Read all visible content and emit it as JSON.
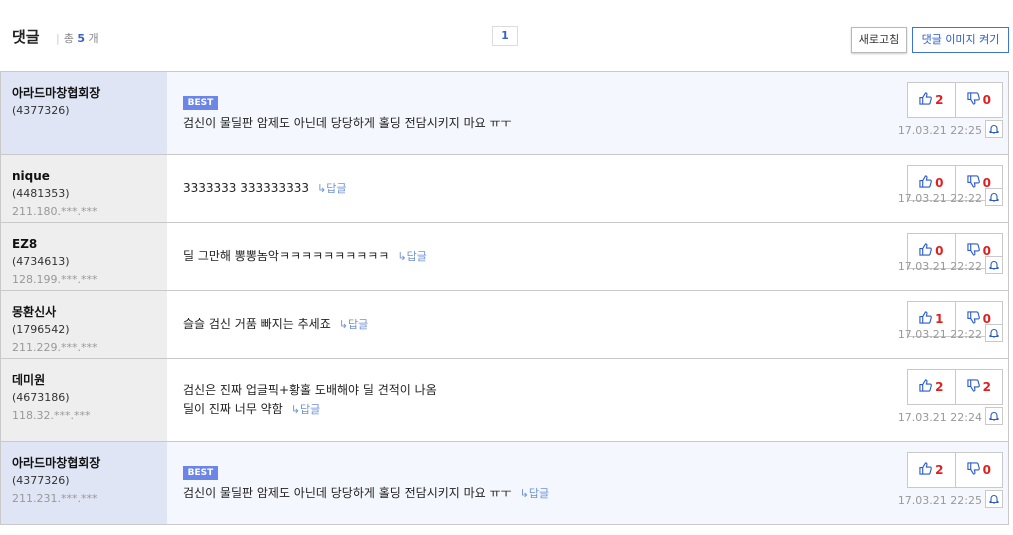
{
  "header": {
    "title": "댓글",
    "count_prefix": "총",
    "count": "5",
    "count_suffix": "개",
    "page": "1",
    "refresh_label": "새로고침",
    "image_toggle_label": "댓글 이미지 켜기"
  },
  "comments": [
    {
      "nick": "아라드마창협회장",
      "uid": "(4377326)",
      "ip": "",
      "best": true,
      "best_label": "BEST",
      "text": "검신이 물딜판 암제도 아닌데 당당하게 홀딩 전담시키지 마요 ㅠㅜ",
      "text2": "",
      "reply": "",
      "up": "2",
      "down": "0",
      "date": "17.03.21 22:25"
    },
    {
      "nick": "nique",
      "uid": "(4481353)",
      "ip": "211.180.***.***",
      "best": false,
      "best_label": "",
      "text": "3333333 333333333",
      "text2": "",
      "reply": "↳답글",
      "up": "0",
      "down": "0",
      "date": "17.03.21 22:22"
    },
    {
      "nick": "EZ8",
      "uid": "(4734613)",
      "ip": "128.199.***.***",
      "best": false,
      "best_label": "",
      "text": "딜 그만해 뽕뽕놈악ㅋㅋㅋㅋㅋㅋㅋㅋㅋㅋ",
      "text2": "",
      "reply": "↳답글",
      "up": "0",
      "down": "0",
      "date": "17.03.21 22:22"
    },
    {
      "nick": "몽환신사",
      "uid": "(1796542)",
      "ip": "211.229.***.***",
      "best": false,
      "best_label": "",
      "text": "슬슬 검신 거품 빠지는 추세죠",
      "text2": "",
      "reply": "↳답글",
      "up": "1",
      "down": "0",
      "date": "17.03.21 22:22"
    },
    {
      "nick": "데미원",
      "uid": "(4673186)",
      "ip": "118.32.***.***",
      "best": false,
      "best_label": "",
      "text": "검신은 진짜 업글픽+황홀 도배해야 딜 견적이 나옴",
      "text2": "딜이 진짜 너무 약함",
      "reply": "↳답글",
      "up": "2",
      "down": "2",
      "date": "17.03.21 22:24"
    },
    {
      "nick": "아라드마창협회장",
      "uid": "(4377326)",
      "ip": "211.231.***.***",
      "best": true,
      "best_label": "BEST",
      "text": "검신이 물딜판 암제도 아닌데 당당하게 홀딩 전담시키지 마요 ㅠㅜ",
      "text2": "",
      "reply": "↳답글",
      "up": "2",
      "down": "0",
      "date": "17.03.21 22:25"
    }
  ]
}
